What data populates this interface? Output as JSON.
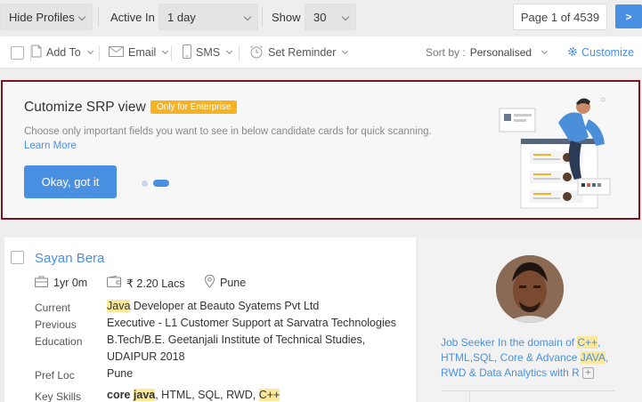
{
  "filters": {
    "hide_profiles": "Hide Profiles",
    "active_in_label": "Active In",
    "active_in_value": "1 day",
    "show_label": "Show",
    "show_value": "30",
    "page_info": "Page 1 of 4539",
    "next_label": ">"
  },
  "actions": {
    "add_to": "Add To",
    "email": "Email",
    "sms": "SMS",
    "set_reminder": "Set Reminder",
    "sort_by_label": "Sort by :",
    "sort_by_value": "Personalised",
    "customize": "Customize"
  },
  "banner": {
    "title": "Cutomize SRP view",
    "badge": "Only for Enterprise",
    "description": "Choose only important fields you want to see in below candidate cards for quick scanning.",
    "learn_more": "Learn More",
    "ok_button": "Okay, got it"
  },
  "candidate": {
    "name": "Sayan Bera",
    "experience": "1yr 0m",
    "salary": "₹ 2.20 Lacs",
    "location": "Pune",
    "current_label": "Current",
    "current_hl": "Java",
    "current_rest": " Developer at Beauto Syatems Pvt Ltd",
    "previous_label": "Previous",
    "previous_value": "Executive - L1 Customer Support at Sarvatra Technologies",
    "education_label": "Education",
    "education_line1": "B.Tech/B.E. Geetanjali Institute of Technical Studies,",
    "education_line2": "UDAIPUR 2018",
    "pref_loc_label": "Pref Loc",
    "pref_loc_value": "Pune",
    "key_skills_label": "Key Skills",
    "skill_1a": "core ",
    "skill_1b": "java",
    "skill_rest": ", HTML, SQL, RWD, ",
    "skill_cpp": "C++",
    "headline_1": "Job Seeker In the domain of ",
    "headline_cpp": "C++",
    "headline_2": ",",
    "headline_3": "HTML,SQL, Core & Advance ",
    "headline_java": "JAVA",
    "headline_4": ",",
    "headline_5": "RWD & Data Analytics with R",
    "plus": "+"
  },
  "colors": {
    "accent": "#4a90e2",
    "banner_border": "#7b1320",
    "badge": "#f5b324",
    "highlight": "#fbe89a"
  }
}
